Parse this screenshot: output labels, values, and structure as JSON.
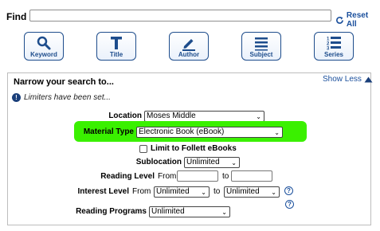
{
  "search": {
    "find_label": "Find",
    "find_value": "",
    "reset_label": "Reset All"
  },
  "search_buttons": [
    {
      "label": "Keyword",
      "icon": "search-icon"
    },
    {
      "label": "Title",
      "icon": "title-t-icon"
    },
    {
      "label": "Author",
      "icon": "pencil-icon"
    },
    {
      "label": "Subject",
      "icon": "list-icon"
    },
    {
      "label": "Series",
      "icon": "numbered-list-icon"
    }
  ],
  "narrow": {
    "title": "Narrow your search to...",
    "show_less": "Show Less",
    "limiters_message": "Limiters have been set...",
    "location_label": "Location",
    "location_value": "Moses Middle",
    "material_label": "Material Type",
    "material_value": "Electronic Book (eBook)",
    "follett_label": "Limit to Follett eBooks",
    "follett_checked": false,
    "sublocation_label": "Sublocation",
    "sublocation_value": "Unlimited",
    "reading_level_label": "Reading Level",
    "from_label": "From",
    "to_label": "to",
    "interest_level_label": "Interest Level",
    "interest_from_value": "Unlimited",
    "interest_to_value": "Unlimited",
    "reading_programs_label": "Reading Programs",
    "reading_programs_value": "Unlimited"
  },
  "colors": {
    "accent": "#1a4f9c",
    "highlight": "#3af000"
  }
}
